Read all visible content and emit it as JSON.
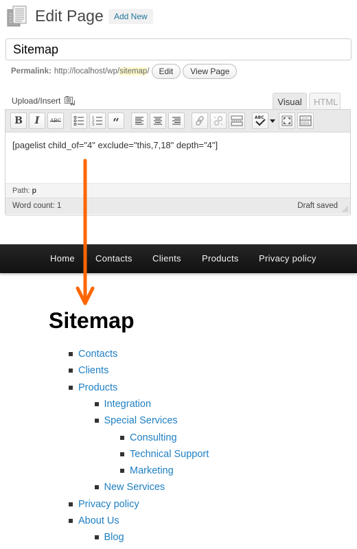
{
  "header": {
    "title": "Edit Page",
    "add_new_label": "Add New",
    "page_icon": "pages-icon"
  },
  "post_title": {
    "value": "Sitemap"
  },
  "permalink": {
    "label": "Permalink:",
    "base_url": "http://localhost/wp/",
    "slug": "sitemap",
    "trailing": "/",
    "edit_label": "Edit",
    "view_label": "View Page"
  },
  "media": {
    "upload_label": "Upload/Insert",
    "icon": "media-gallery-icon"
  },
  "editor_tabs": [
    {
      "label": "Visual",
      "active": true
    },
    {
      "label": "HTML",
      "active": false
    }
  ],
  "toolbar": {
    "buttons": [
      {
        "name": "bold",
        "glyph": "B"
      },
      {
        "name": "italic",
        "glyph": "I"
      },
      {
        "name": "strikethrough",
        "glyph": "ABC"
      },
      {
        "name": "bullet-list",
        "glyph": ""
      },
      {
        "name": "numbered-list",
        "glyph": ""
      },
      {
        "name": "blockquote",
        "glyph": "“"
      },
      {
        "name": "align-left",
        "glyph": ""
      },
      {
        "name": "align-center",
        "glyph": ""
      },
      {
        "name": "align-right",
        "glyph": ""
      },
      {
        "name": "insert-link",
        "glyph": ""
      },
      {
        "name": "unlink",
        "glyph": ""
      },
      {
        "name": "insert-more",
        "glyph": ""
      },
      {
        "name": "spellcheck",
        "glyph": "ABC"
      },
      {
        "name": "fullscreen",
        "glyph": ""
      },
      {
        "name": "kitchen-sink",
        "glyph": ""
      }
    ]
  },
  "editor": {
    "content": "[pagelist child_of=\"4\" exclude=\"this,7,18\" depth=\"4\"]",
    "path_label": "Path:",
    "path_value": "p",
    "word_count": "Word count: 1",
    "status": "Draft saved"
  },
  "site_nav": {
    "items": [
      "Home",
      "Contacts",
      "Clients",
      "Products",
      "Privacy policy"
    ]
  },
  "sitemap": {
    "title": "Sitemap",
    "items": [
      {
        "label": "Contacts",
        "level": 0
      },
      {
        "label": "Clients",
        "level": 0
      },
      {
        "label": "Products",
        "level": 0
      },
      {
        "label": "Integration",
        "level": 1
      },
      {
        "label": "Special Services",
        "level": 1
      },
      {
        "label": "Consulting",
        "level": 2
      },
      {
        "label": "Technical Support",
        "level": 2
      },
      {
        "label": "Marketing",
        "level": 2
      },
      {
        "label": "New Services",
        "level": 1
      },
      {
        "label": "Privacy policy",
        "level": 0
      },
      {
        "label": "About Us",
        "level": 0
      },
      {
        "label": "Blog",
        "level": 1
      }
    ]
  },
  "annotation": {
    "arrow_color": "#ff6600",
    "direction": "down"
  },
  "colors": {
    "link": "#1e7fc2",
    "wp_link": "#21759b",
    "nav_bg": "#1a1a1a",
    "slug_highlight": "#fffbcc"
  }
}
